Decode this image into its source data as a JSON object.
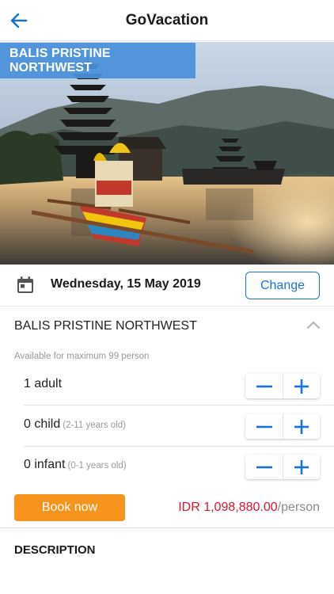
{
  "header": {
    "title": "GoVacation",
    "back_icon": "arrow-left-icon"
  },
  "hero": {
    "badge": "BALIS PRISTINE NORTHWEST"
  },
  "date_row": {
    "icon": "calendar-icon",
    "date": "Wednesday, 15 May 2019",
    "change_label": "Change"
  },
  "package": {
    "title": "BALIS PRISTINE NORTHWEST",
    "collapse_icon": "chevron-up-icon",
    "availability": "Available for maximum 99 person"
  },
  "guests": [
    {
      "label": "1 adult",
      "note": ""
    },
    {
      "label": "0 child",
      "note": "(2-11 years old)"
    },
    {
      "label": "0 infant",
      "note": "(0-1 years old)"
    }
  ],
  "booking": {
    "book_label": "Book now",
    "price": "IDR 1,098,880.00",
    "price_unit": "/person"
  },
  "description": {
    "title": "DESCRIPTION"
  },
  "colors": {
    "accent": "#1a73d9",
    "badge": "#4a90d9",
    "book_button": "#f7941d",
    "price": "#e0162b"
  }
}
